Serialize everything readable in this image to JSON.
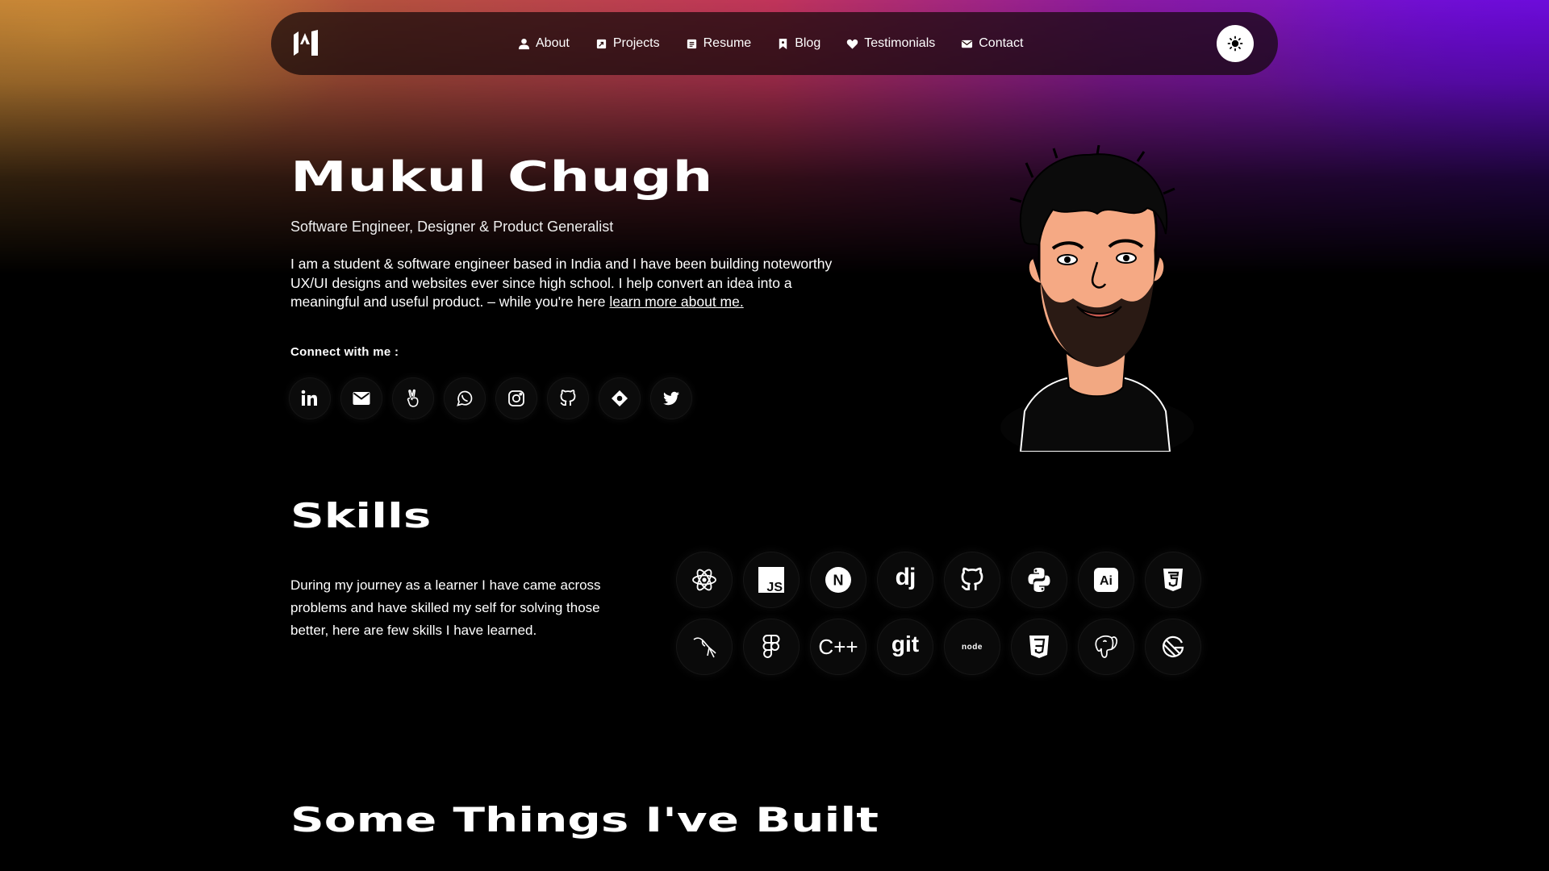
{
  "nav": {
    "logo": "M",
    "items": [
      {
        "label": "About",
        "icon": "user-icon"
      },
      {
        "label": "Projects",
        "icon": "projects-icon"
      },
      {
        "label": "Resume",
        "icon": "resume-icon"
      },
      {
        "label": "Blog",
        "icon": "bookmark-icon"
      },
      {
        "label": "Testimonials",
        "icon": "heart-icon"
      },
      {
        "label": "Contact",
        "icon": "envelope-icon"
      }
    ],
    "theme_toggle_icon": "sun-icon"
  },
  "hero": {
    "name": "Mukul Chugh",
    "tagline": "Software Engineer, Designer & Product Generalist",
    "bio": "I am a student & software engineer based in India and I have been building noteworthy UX/UI designs and websites ever since high school. I help convert an idea into a meaningful and useful product. –  while you're here ",
    "bio_link": "learn more about me.",
    "connect_label": "Connect with me :",
    "socials": [
      "linkedin-icon",
      "mail-icon",
      "angellist-icon",
      "whatsapp-icon",
      "instagram-icon",
      "github-icon",
      "hashnode-icon",
      "twitter-icon"
    ]
  },
  "skills": {
    "title": "Skills",
    "description": "During my journey as a learner I have came across problems and have skilled my self for solving those better, here are few skills I have learned.",
    "items": [
      {
        "name": "react-icon",
        "text": ""
      },
      {
        "name": "javascript-icon",
        "text": "JS"
      },
      {
        "name": "nextjs-icon",
        "text": "N"
      },
      {
        "name": "django-icon",
        "text": "dj"
      },
      {
        "name": "github-icon",
        "text": ""
      },
      {
        "name": "python-icon",
        "text": ""
      },
      {
        "name": "illustrator-icon",
        "text": "Ai"
      },
      {
        "name": "html5-icon",
        "text": "5"
      },
      {
        "name": "mysql-icon",
        "text": ""
      },
      {
        "name": "figma-icon",
        "text": ""
      },
      {
        "name": "cpp-icon",
        "text": "C++"
      },
      {
        "name": "git-icon",
        "text": "git"
      },
      {
        "name": "nodejs-icon",
        "text": "node"
      },
      {
        "name": "css3-icon",
        "text": "3"
      },
      {
        "name": "postgresql-icon",
        "text": ""
      },
      {
        "name": "gatsby-icon",
        "text": ""
      }
    ]
  },
  "projects": {
    "title": "Some Things I've Built"
  },
  "colors": {
    "background": "#000000",
    "glow_left": "#b97a33",
    "glow_mid": "#c0345a",
    "glow_right": "#6a10d8"
  }
}
